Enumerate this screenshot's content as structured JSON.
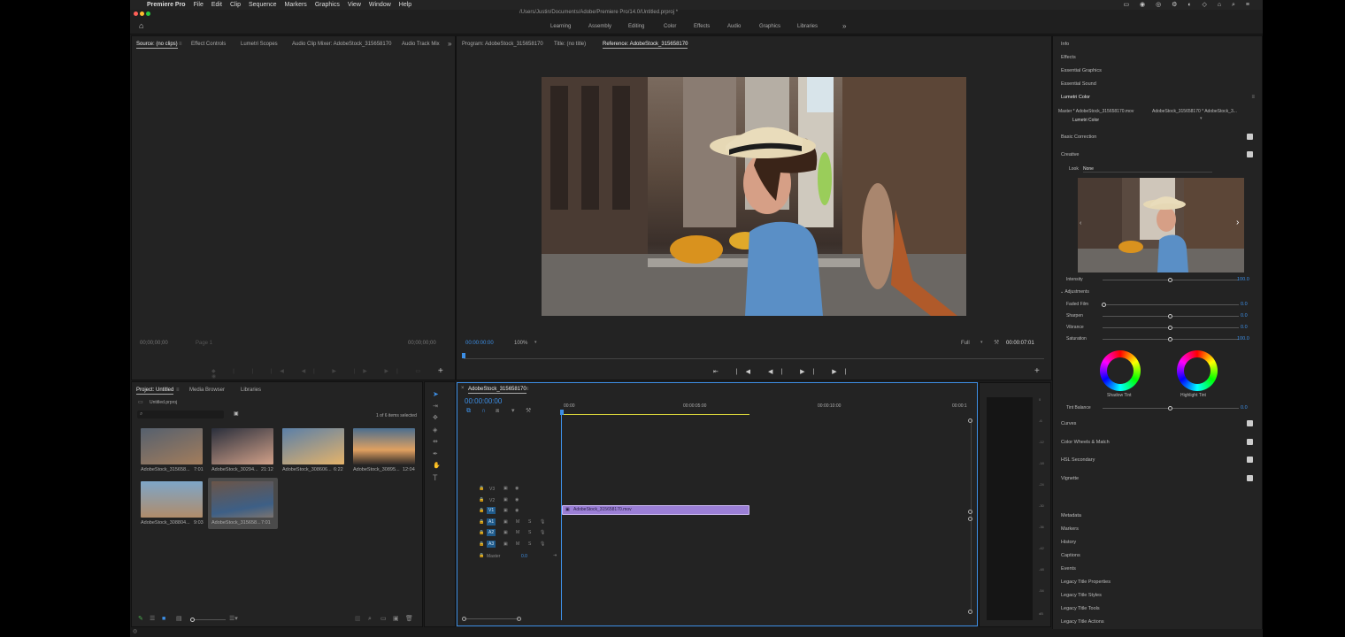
{
  "menubar": {
    "app": "Premiere Pro",
    "items": [
      "File",
      "Edit",
      "Clip",
      "Sequence",
      "Markers",
      "Graphics",
      "View",
      "Window",
      "Help"
    ]
  },
  "window_title": "/Users/Justin/Documents/Adobe/Premiere Pro/14.0/Untitled.prproj *",
  "workspaces": [
    "Learning",
    "Assembly",
    "Editing",
    "Color",
    "Effects",
    "Audio",
    "Graphics",
    "Libraries"
  ],
  "source_panel": {
    "tabs": [
      "Source: (no clips)",
      "Effect Controls",
      "Lumetri Scopes",
      "Audio Clip Mixer: AdobeStock_315658170",
      "Audio Track Mix"
    ],
    "timecode_left": "00;00;00;00",
    "page": "Page 1",
    "timecode_right": "00;00;00;00"
  },
  "program_panel": {
    "tabs": [
      "Program: AdobeStock_315658170",
      "Title: (no title)",
      "Reference: AdobeStock_315658170"
    ],
    "timecode": "00:00:00:00",
    "zoom": "100%",
    "quality": "Full",
    "duration": "00:00:07:01"
  },
  "project_panel": {
    "tabs": [
      "Project: Untitled",
      "Media Browser",
      "Libraries"
    ],
    "file": "Untitled.prproj",
    "selection_info": "1 of 6 items selected",
    "items": [
      {
        "name": "AdobeStock_315658...",
        "duration": "7:01"
      },
      {
        "name": "AdobeStock_30294...",
        "duration": "21:12"
      },
      {
        "name": "AdobeStock_308606...",
        "duration": "6:22"
      },
      {
        "name": "AdobeStock_30895...",
        "duration": "12:04"
      },
      {
        "name": "AdobeStock_308804...",
        "duration": "9:03"
      },
      {
        "name": "AdobeStock_315658...",
        "duration": "7:01"
      }
    ]
  },
  "timeline": {
    "tab": "AdobeStock_315658170",
    "timecode": "00:00:00:00",
    "ruler": [
      "00:00",
      "00:00:05:00",
      "00:00:10:00",
      "00:00:1"
    ],
    "video_tracks": [
      "V3",
      "V2",
      "V1"
    ],
    "audio_tracks": [
      "A1",
      "A2",
      "A3"
    ],
    "clip_name": "AdobeStock_315658170.mov",
    "master_label": "Master",
    "master_value": "0.0",
    "meter_scale": [
      "0",
      "-6",
      "-12",
      "-18",
      "-24",
      "-30",
      "-36",
      "-42",
      "-48",
      "-54",
      "dB"
    ]
  },
  "right_panel": {
    "collapsed_top": [
      "Info",
      "Effects",
      "Essential Graphics",
      "Essential Sound",
      "Lumetri Color"
    ],
    "master_label": "Master * AdobeStock_315658170.mov",
    "master_link": "AdobeStock_315658170 * AdobeStock_3...",
    "effect": "Lumetri Color",
    "sections": {
      "basic": "Basic Correction",
      "creative": "Creative"
    },
    "look_label": "Look",
    "look_value": "None",
    "intensity": {
      "label": "Intensity",
      "value": "100.0"
    },
    "adjustments_label": "Adjustments",
    "adjustments": [
      {
        "label": "Faded Film",
        "value": "0.0"
      },
      {
        "label": "Sharpen",
        "value": "0.0"
      },
      {
        "label": "Vibrance",
        "value": "0.0"
      },
      {
        "label": "Saturation",
        "value": "100.0"
      }
    ],
    "wheels": [
      "Shadow Tint",
      "Highlight Tint"
    ],
    "tint_balance": {
      "label": "Tint Balance",
      "value": "0.0"
    },
    "more_sections": [
      "Curves",
      "Color Wheels & Match",
      "HSL Secondary",
      "Vignette"
    ],
    "collapsed_bottom": [
      "Metadata",
      "Markers",
      "History",
      "Captions",
      "Events",
      "Legacy Title Properties",
      "Legacy Title Styles",
      "Legacy Title Tools",
      "Legacy Title Actions"
    ]
  }
}
